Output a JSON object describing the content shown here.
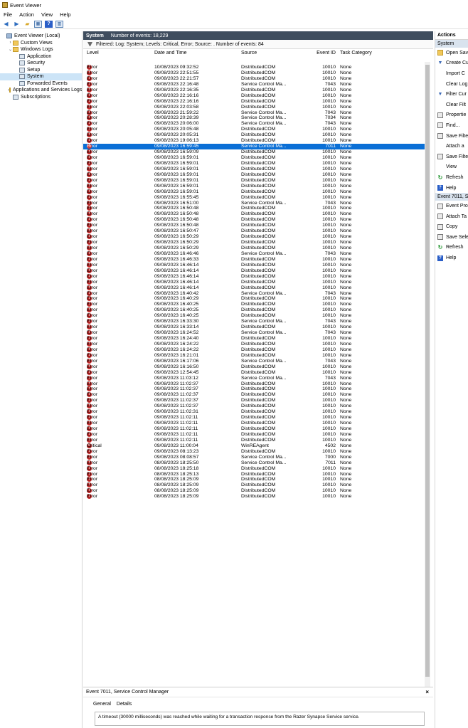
{
  "window": {
    "title": "Event Viewer"
  },
  "menu": [
    "File",
    "Action",
    "View",
    "Help"
  ],
  "tree": [
    {
      "label": "Event Viewer (Local)",
      "indent": 0,
      "exp": "",
      "icon": "pc"
    },
    {
      "label": "Custom Views",
      "indent": 1,
      "exp": "›",
      "icon": "fld"
    },
    {
      "label": "Windows Logs",
      "indent": 1,
      "exp": "⌄",
      "icon": "fld"
    },
    {
      "label": "Application",
      "indent": 2,
      "exp": "",
      "icon": "log"
    },
    {
      "label": "Security",
      "indent": 2,
      "exp": "",
      "icon": "log"
    },
    {
      "label": "Setup",
      "indent": 2,
      "exp": "",
      "icon": "log"
    },
    {
      "label": "System",
      "indent": 2,
      "exp": "",
      "icon": "log",
      "selected": true
    },
    {
      "label": "Forwarded Events",
      "indent": 2,
      "exp": "",
      "icon": "log"
    },
    {
      "label": "Applications and Services Logs",
      "indent": 1,
      "exp": "›",
      "icon": "fld"
    },
    {
      "label": "Subscriptions",
      "indent": 1,
      "exp": "",
      "icon": "log"
    }
  ],
  "center": {
    "header_title": "System",
    "header_count": "Number of events: 18,229",
    "filter_text": "Filtered: Log: System; Levels: Critical, Error; Source: . Number of events: 84",
    "columns": [
      "Level",
      "Date and Time",
      "Source",
      "Event ID",
      "Task Category"
    ]
  },
  "events": [
    [
      "Error",
      "10/08/2023 09:32:52",
      "DistributedCOM",
      "10010",
      "None"
    ],
    [
      "Error",
      "09/08/2023 22:51:55",
      "DistributedCOM",
      "10010",
      "None"
    ],
    [
      "Error",
      "09/08/2023 22:21:57",
      "DistributedCOM",
      "10010",
      "None"
    ],
    [
      "Error",
      "09/08/2023 22:16:48",
      "Service Control Ma...",
      "7043",
      "None"
    ],
    [
      "Error",
      "09/08/2023 22:16:35",
      "DistributedCOM",
      "10010",
      "None"
    ],
    [
      "Error",
      "09/08/2023 22:16:16",
      "DistributedCOM",
      "10010",
      "None"
    ],
    [
      "Error",
      "09/08/2023 22:16:16",
      "DistributedCOM",
      "10010",
      "None"
    ],
    [
      "Error",
      "09/08/2023 22:03:58",
      "DistributedCOM",
      "10010",
      "None"
    ],
    [
      "Error",
      "09/08/2023 21:59:22",
      "Service Control Ma...",
      "7043",
      "None"
    ],
    [
      "Error",
      "09/08/2023 20:28:39",
      "Service Control Ma...",
      "7034",
      "None"
    ],
    [
      "Error",
      "09/08/2023 20:06:00",
      "Service Control Ma...",
      "7043",
      "None"
    ],
    [
      "Error",
      "09/08/2023 20:05:48",
      "DistributedCOM",
      "10010",
      "None"
    ],
    [
      "Error",
      "09/08/2023 20:05:31",
      "DistributedCOM",
      "10010",
      "None"
    ],
    [
      "Error",
      "09/08/2023 19:06:13",
      "DistributedCOM",
      "10010",
      "None"
    ],
    [
      "Error",
      "09/08/2023 16:59:45",
      "Service Control Ma...",
      "7011",
      "None"
    ],
    [
      "Error",
      "09/08/2023 16:59:09",
      "DistributedCOM",
      "10010",
      "None"
    ],
    [
      "Error",
      "09/08/2023 16:59:01",
      "DistributedCOM",
      "10010",
      "None"
    ],
    [
      "Error",
      "09/08/2023 16:59:01",
      "DistributedCOM",
      "10010",
      "None"
    ],
    [
      "Error",
      "09/08/2023 16:59:01",
      "DistributedCOM",
      "10010",
      "None"
    ],
    [
      "Error",
      "09/08/2023 16:59:01",
      "DistributedCOM",
      "10010",
      "None"
    ],
    [
      "Error",
      "09/08/2023 16:59:01",
      "DistributedCOM",
      "10010",
      "None"
    ],
    [
      "Error",
      "09/08/2023 16:59:01",
      "DistributedCOM",
      "10010",
      "None"
    ],
    [
      "Error",
      "09/08/2023 16:59:01",
      "DistributedCOM",
      "10010",
      "None"
    ],
    [
      "Error",
      "09/08/2023 16:55:45",
      "DistributedCOM",
      "10010",
      "None"
    ],
    [
      "Error",
      "09/08/2023 16:51:00",
      "Service Control Ma...",
      "7043",
      "None"
    ],
    [
      "Error",
      "09/08/2023 16:50:48",
      "DistributedCOM",
      "10010",
      "None"
    ],
    [
      "Error",
      "09/08/2023 16:50:48",
      "DistributedCOM",
      "10010",
      "None"
    ],
    [
      "Error",
      "09/08/2023 16:50:48",
      "DistributedCOM",
      "10010",
      "None"
    ],
    [
      "Error",
      "09/08/2023 16:50:48",
      "DistributedCOM",
      "10010",
      "None"
    ],
    [
      "Error",
      "09/08/2023 16:50:47",
      "DistributedCOM",
      "10010",
      "None"
    ],
    [
      "Error",
      "09/08/2023 16:50:29",
      "DistributedCOM",
      "10010",
      "None"
    ],
    [
      "Error",
      "09/08/2023 16:50:29",
      "DistributedCOM",
      "10010",
      "None"
    ],
    [
      "Error",
      "09/08/2023 16:50:29",
      "DistributedCOM",
      "10010",
      "None"
    ],
    [
      "Error",
      "09/08/2023 16:46:46",
      "Service Control Ma...",
      "7043",
      "None"
    ],
    [
      "Error",
      "09/08/2023 16:46:33",
      "DistributedCOM",
      "10010",
      "None"
    ],
    [
      "Error",
      "09/08/2023 16:46:14",
      "DistributedCOM",
      "10010",
      "None"
    ],
    [
      "Error",
      "09/08/2023 16:46:14",
      "DistributedCOM",
      "10010",
      "None"
    ],
    [
      "Error",
      "09/08/2023 16:46:14",
      "DistributedCOM",
      "10010",
      "None"
    ],
    [
      "Error",
      "09/08/2023 16:46:14",
      "DistributedCOM",
      "10010",
      "None"
    ],
    [
      "Error",
      "09/08/2023 16:46:14",
      "DistributedCOM",
      "10010",
      "None"
    ],
    [
      "Error",
      "09/08/2023 16:40:42",
      "Service Control Ma...",
      "7043",
      "None"
    ],
    [
      "Error",
      "09/08/2023 16:40:29",
      "DistributedCOM",
      "10010",
      "None"
    ],
    [
      "Error",
      "09/08/2023 16:40:25",
      "DistributedCOM",
      "10010",
      "None"
    ],
    [
      "Error",
      "09/08/2023 16:40:25",
      "DistributedCOM",
      "10010",
      "None"
    ],
    [
      "Error",
      "09/08/2023 16:40:25",
      "DistributedCOM",
      "10010",
      "None"
    ],
    [
      "Error",
      "09/08/2023 16:33:30",
      "Service Control Ma...",
      "7043",
      "None"
    ],
    [
      "Error",
      "09/08/2023 16:33:14",
      "DistributedCOM",
      "10010",
      "None"
    ],
    [
      "Error",
      "09/08/2023 16:24:52",
      "Service Control Ma...",
      "7043",
      "None"
    ],
    [
      "Error",
      "09/08/2023 16:24:40",
      "DistributedCOM",
      "10010",
      "None"
    ],
    [
      "Error",
      "09/08/2023 16:24:22",
      "DistributedCOM",
      "10010",
      "None"
    ],
    [
      "Error",
      "09/08/2023 16:24:22",
      "DistributedCOM",
      "10010",
      "None"
    ],
    [
      "Error",
      "09/08/2023 16:21:01",
      "DistributedCOM",
      "10010",
      "None"
    ],
    [
      "Error",
      "09/08/2023 16:17:06",
      "Service Control Ma...",
      "7043",
      "None"
    ],
    [
      "Error",
      "09/08/2023 16:16:50",
      "DistributedCOM",
      "10010",
      "None"
    ],
    [
      "Error",
      "09/08/2023 12:54:45",
      "DistributedCOM",
      "10010",
      "None"
    ],
    [
      "Error",
      "09/08/2023 11:03:12",
      "Service Control Ma...",
      "7043",
      "None"
    ],
    [
      "Error",
      "09/08/2023 11:02:37",
      "DistributedCOM",
      "10010",
      "None"
    ],
    [
      "Error",
      "09/08/2023 11:02:37",
      "DistributedCOM",
      "10010",
      "None"
    ],
    [
      "Error",
      "09/08/2023 11:02:37",
      "DistributedCOM",
      "10010",
      "None"
    ],
    [
      "Error",
      "09/08/2023 11:02:37",
      "DistributedCOM",
      "10010",
      "None"
    ],
    [
      "Error",
      "09/08/2023 11:02:37",
      "DistributedCOM",
      "10010",
      "None"
    ],
    [
      "Error",
      "09/08/2023 11:02:31",
      "DistributedCOM",
      "10010",
      "None"
    ],
    [
      "Error",
      "09/08/2023 11:02:11",
      "DistributedCOM",
      "10010",
      "None"
    ],
    [
      "Error",
      "09/08/2023 11:02:11",
      "DistributedCOM",
      "10010",
      "None"
    ],
    [
      "Error",
      "09/08/2023 11:02:11",
      "DistributedCOM",
      "10010",
      "None"
    ],
    [
      "Error",
      "09/08/2023 11:02:11",
      "DistributedCOM",
      "10010",
      "None"
    ],
    [
      "Error",
      "09/08/2023 11:02:11",
      "DistributedCOM",
      "10010",
      "None"
    ],
    [
      "Critical",
      "09/08/2023 11:00:04",
      "WinREAgent",
      "4502",
      "None"
    ],
    [
      "Error",
      "09/08/2023 08:13:23",
      "DistributedCOM",
      "10010",
      "None"
    ],
    [
      "Error",
      "09/08/2023 08:08:57",
      "Service Control Ma...",
      "7000",
      "None"
    ],
    [
      "Error",
      "08/08/2023 18:25:50",
      "Service Control Ma...",
      "7011",
      "None"
    ],
    [
      "Error",
      "08/08/2023 18:25:18",
      "DistributedCOM",
      "10010",
      "None"
    ],
    [
      "Error",
      "08/08/2023 18:25:13",
      "DistributedCOM",
      "10010",
      "None"
    ],
    [
      "Error",
      "08/08/2023 18:25:09",
      "DistributedCOM",
      "10010",
      "None"
    ],
    [
      "Error",
      "08/08/2023 18:25:09",
      "DistributedCOM",
      "10010",
      "None"
    ],
    [
      "Error",
      "08/08/2023 18:25:09",
      "DistributedCOM",
      "10010",
      "None"
    ],
    [
      "Error",
      "08/08/2023 18:25:09",
      "DistributedCOM",
      "10010",
      "None"
    ]
  ],
  "selected_index": 14,
  "detail": {
    "title": "Event 7011, Service Control Manager",
    "close": "×",
    "tabs": [
      "General",
      "Details"
    ],
    "message": "A timeout (30000 milliseconds) was reached while waiting for a transaction response from the Razer Synapse Service service."
  },
  "actions": {
    "title": "Actions",
    "section1": "System",
    "items1": [
      {
        "label": "Open Sav",
        "icon": "fld"
      },
      {
        "label": "Create Cu",
        "icon": "filter"
      },
      {
        "label": "Import C",
        "icon": "none"
      },
      {
        "label": "Clear Log",
        "icon": "none"
      },
      {
        "label": "Filter Cur",
        "icon": "filter"
      },
      {
        "label": "Clear Filt",
        "icon": "none"
      },
      {
        "label": "Propertie",
        "icon": "gray"
      },
      {
        "label": "Find...",
        "icon": "gray"
      },
      {
        "label": "Save Filte",
        "icon": "gray"
      },
      {
        "label": "Attach a",
        "icon": "none"
      },
      {
        "label": "Save Filte",
        "icon": "gray"
      },
      {
        "label": "View",
        "icon": "none"
      },
      {
        "label": "Refresh",
        "icon": "green"
      },
      {
        "label": "Help",
        "icon": "blue"
      }
    ],
    "section2": "Event 7011, Se",
    "items2": [
      {
        "label": "Event Pro",
        "icon": "gray"
      },
      {
        "label": "Attach Ta",
        "icon": "gray"
      },
      {
        "label": "Copy",
        "icon": "gray"
      },
      {
        "label": "Save Sele",
        "icon": "gray"
      },
      {
        "label": "Refresh",
        "icon": "green"
      },
      {
        "label": "Help",
        "icon": "blue"
      }
    ]
  }
}
